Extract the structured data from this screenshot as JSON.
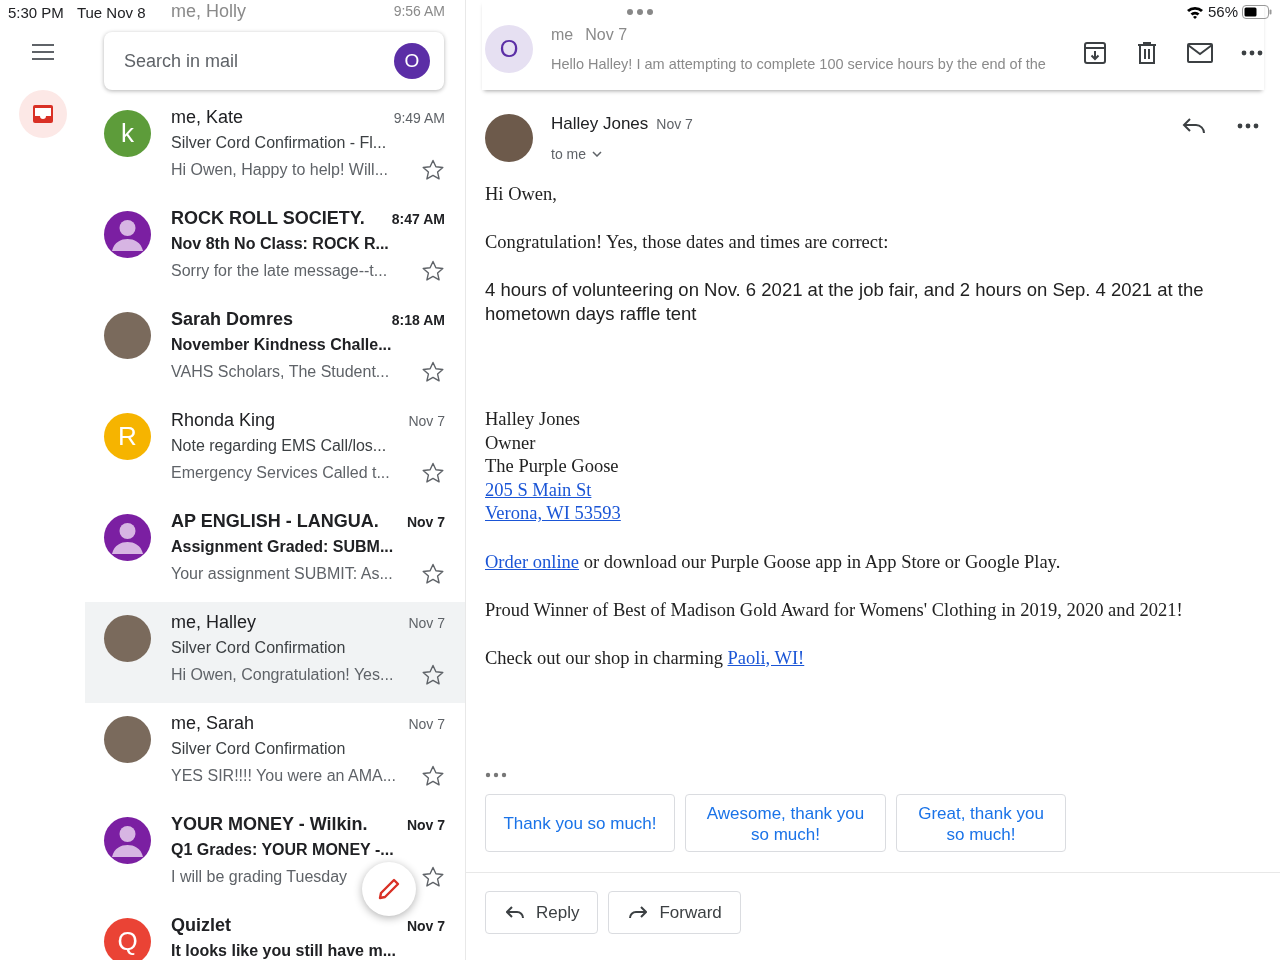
{
  "status_bar": {
    "time": "5:30 PM",
    "date": "Tue Nov 8",
    "battery": "56%"
  },
  "search": {
    "placeholder": "Search in mail",
    "account_initial": "O"
  },
  "ghost_row": {
    "sender": "me, Holly",
    "time": "9:56 AM"
  },
  "emails": [
    {
      "sender": "me, Kate",
      "time": "9:49 AM",
      "subject": "Silver Cord Confirmation - Fl...",
      "snippet": "Hi Owen, Happy to help! Will...",
      "unread": false,
      "selected": false,
      "starred": false,
      "avatar": {
        "kind": "letter",
        "letter": "k",
        "color": "#5d9c3a"
      }
    },
    {
      "sender": "ROCK  ROLL SOCIETY.",
      "time": "8:47 AM",
      "subject": "Nov 8th No Class: ROCK  R...",
      "snippet": "Sorry for the late message--t...",
      "unread": true,
      "selected": false,
      "starred": false,
      "avatar": {
        "kind": "person",
        "color": "#7b1fa2"
      }
    },
    {
      "sender": "Sarah Domres",
      "time": "8:18 AM",
      "subject": "November Kindness Challe...",
      "snippet": "VAHS Scholars, The Student...",
      "unread": true,
      "selected": false,
      "starred": false,
      "avatar": {
        "kind": "photo"
      }
    },
    {
      "sender": "Rhonda King",
      "time": "Nov 7",
      "subject": "Note regarding EMS Call/los...",
      "snippet": "Emergency Services Called t...",
      "unread": false,
      "selected": false,
      "starred": false,
      "avatar": {
        "kind": "letter",
        "letter": "R",
        "color": "#f6b400"
      }
    },
    {
      "sender": "AP ENGLISH - LANGUA.",
      "time": "Nov 7",
      "subject": "Assignment Graded: SUBM...",
      "snippet": "Your assignment SUBMIT: As...",
      "unread": true,
      "selected": false,
      "starred": false,
      "avatar": {
        "kind": "person",
        "color": "#7b1fa2"
      }
    },
    {
      "sender": "me, Halley",
      "time": "Nov 7",
      "subject": "Silver Cord Confirmation",
      "snippet": "Hi Owen, Congratulation! Yes...",
      "unread": false,
      "selected": true,
      "starred": false,
      "avatar": {
        "kind": "photo"
      }
    },
    {
      "sender": "me, Sarah",
      "time": "Nov 7",
      "subject": "Silver Cord Confirmation",
      "snippet": "YES SIR!!!! You were an AMA...",
      "unread": false,
      "selected": false,
      "starred": false,
      "avatar": {
        "kind": "photo"
      }
    },
    {
      "sender": "YOUR MONEY - Wilkin.",
      "time": "Nov 7",
      "subject": "Q1 Grades: YOUR MONEY -...",
      "snippet": "I will be grading Tuesday",
      "unread": true,
      "selected": false,
      "starred": false,
      "avatar": {
        "kind": "person",
        "color": "#7b1fa2"
      }
    },
    {
      "sender": "Quizlet",
      "time": "Nov 7",
      "subject": "It looks like you still have m...",
      "unread": true,
      "selected": false,
      "avatar": {
        "kind": "letter",
        "letter": "Q",
        "color": "#ea4335"
      }
    }
  ],
  "ghost_message": {
    "initial": "O",
    "sender": "me",
    "date": "Nov 7",
    "snippet": "Hello Halley! I am attempting to complete 100 service hours by the end of the"
  },
  "message": {
    "sender": "Halley Jones",
    "date": "Nov 7",
    "recipient": "to me",
    "paragraphs": [
      {
        "kind": "serif",
        "segments": [
          {
            "text": "Hi Owen,",
            "link": false
          }
        ]
      },
      {
        "kind": "serif",
        "segments": [
          {
            "text": "Congratulation!  Yes, those dates and times are correct:",
            "link": false
          }
        ]
      },
      {
        "kind": "sans",
        "segments": [
          {
            "text": "4 hours of volunteering on Nov. 6 2021 at the job fair, and 2 hours on Sep. 4 2021 at the hometown days raffle tent",
            "link": false
          }
        ]
      },
      {
        "kind": "signature",
        "lines": [
          {
            "text": "Halley Jones",
            "link": false
          },
          {
            "text": "Owner",
            "link": false
          },
          {
            "text": "The Purple Goose",
            "link": false
          },
          {
            "text": "205 S Main St",
            "link": true
          },
          {
            "text": "Verona, WI 53593",
            "link": true
          }
        ]
      },
      {
        "kind": "serif",
        "segments": [
          {
            "text": "Order online",
            "link": true
          },
          {
            "text": " or download our Purple Goose app in App Store or Google Play.",
            "link": false
          }
        ]
      },
      {
        "kind": "serif",
        "segments": [
          {
            "text": "Proud Winner of Best of Madison Gold Award for Womens' Clothing in 2019, 2020 and 2021!",
            "link": false
          }
        ]
      },
      {
        "kind": "serif",
        "segments": [
          {
            "text": "Check out our shop in charming ",
            "link": false
          },
          {
            "text": "Paoli, WI!",
            "link": true
          }
        ]
      }
    ]
  },
  "smart_replies": [
    "Thank you so much!",
    "Awesome, thank you so much!",
    "Great, thank you so much!"
  ],
  "actions": [
    {
      "kind": "reply",
      "label": "Reply"
    },
    {
      "kind": "forward",
      "label": "Forward"
    }
  ]
}
